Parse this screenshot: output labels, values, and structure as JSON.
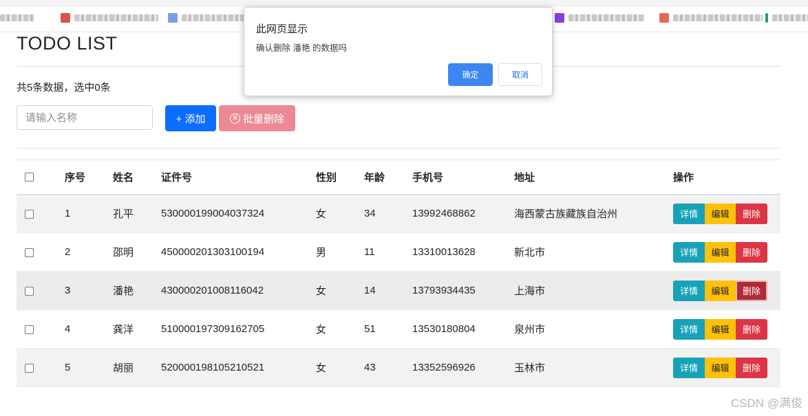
{
  "page": {
    "title": "TODO LIST",
    "summary": "共5条数据，选中0条"
  },
  "toolbar": {
    "name_placeholder": "请输入名称",
    "add_label": "+ 添加",
    "batch_delete_label": "批量删除"
  },
  "table": {
    "headers": [
      "序号",
      "姓名",
      "证件号",
      "性别",
      "年龄",
      "手机号",
      "地址",
      "操作"
    ],
    "rows": [
      {
        "seq": "1",
        "name": "孔平",
        "id": "530000199004037324",
        "sex": "女",
        "age": "34",
        "phone": "13992468862",
        "address": "海西蒙古族藏族自治州"
      },
      {
        "seq": "2",
        "name": "邵明",
        "id": "450000201303100194",
        "sex": "男",
        "age": "11",
        "phone": "13310013628",
        "address": "新北市"
      },
      {
        "seq": "3",
        "name": "潘艳",
        "id": "430000201008116042",
        "sex": "女",
        "age": "14",
        "phone": "13793934435",
        "address": "上海市"
      },
      {
        "seq": "4",
        "name": "龚洋",
        "id": "510000197309162705",
        "sex": "女",
        "age": "51",
        "phone": "13530180804",
        "address": "泉州市"
      },
      {
        "seq": "5",
        "name": "胡丽",
        "id": "520000198105210521",
        "sex": "女",
        "age": "43",
        "phone": "13352596926",
        "address": "玉林市"
      }
    ],
    "actions": {
      "detail": "详情",
      "edit": "编辑",
      "delete": "删除"
    }
  },
  "dialog": {
    "title": "此网页显示",
    "message": "确认删除 潘艳 的数据吗",
    "ok_label": "确定",
    "cancel_label": "取消"
  },
  "watermark": "CSDN @满俊",
  "colors": {
    "primary": "#0d6efd",
    "info": "#17a2b8",
    "warning": "#ffc107",
    "danger": "#dc3545",
    "danger_disabled": "#eb8a93",
    "dialog_ok": "#3b86f0"
  }
}
